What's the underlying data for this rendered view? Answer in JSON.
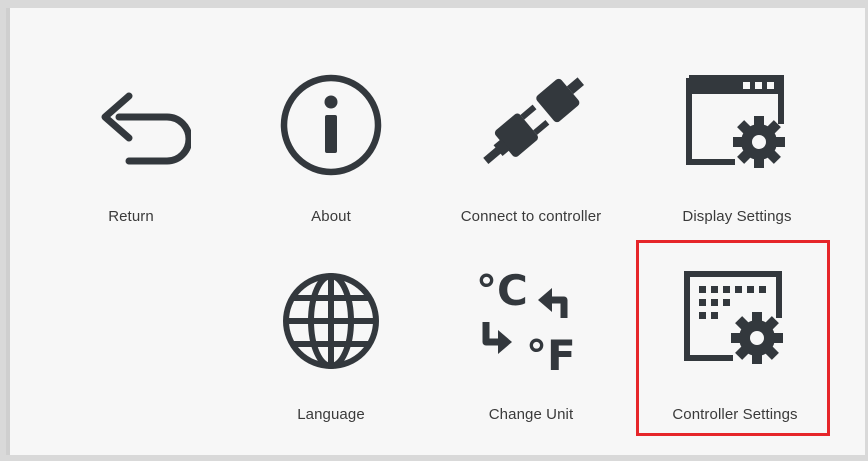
{
  "menu": {
    "items": [
      {
        "id": "return",
        "label": "Return",
        "icon": "return-arrow-icon"
      },
      {
        "id": "about",
        "label": "About",
        "icon": "info-icon"
      },
      {
        "id": "connect",
        "label": "Connect to controller",
        "icon": "plug-icon"
      },
      {
        "id": "display",
        "label": "Display Settings",
        "icon": "display-settings-icon"
      },
      {
        "id": "language",
        "label": "Language",
        "icon": "globe-icon"
      },
      {
        "id": "unit",
        "label": "Change Unit",
        "icon": "temperature-unit-icon"
      },
      {
        "id": "controller",
        "label": "Controller Settings",
        "icon": "controller-settings-icon"
      }
    ],
    "unit_glyphs": {
      "celsius": "°C",
      "fahrenheit": "°F"
    },
    "highlighted_item": "controller",
    "highlight_color": "#e6262a",
    "icon_color": "#33383d"
  }
}
